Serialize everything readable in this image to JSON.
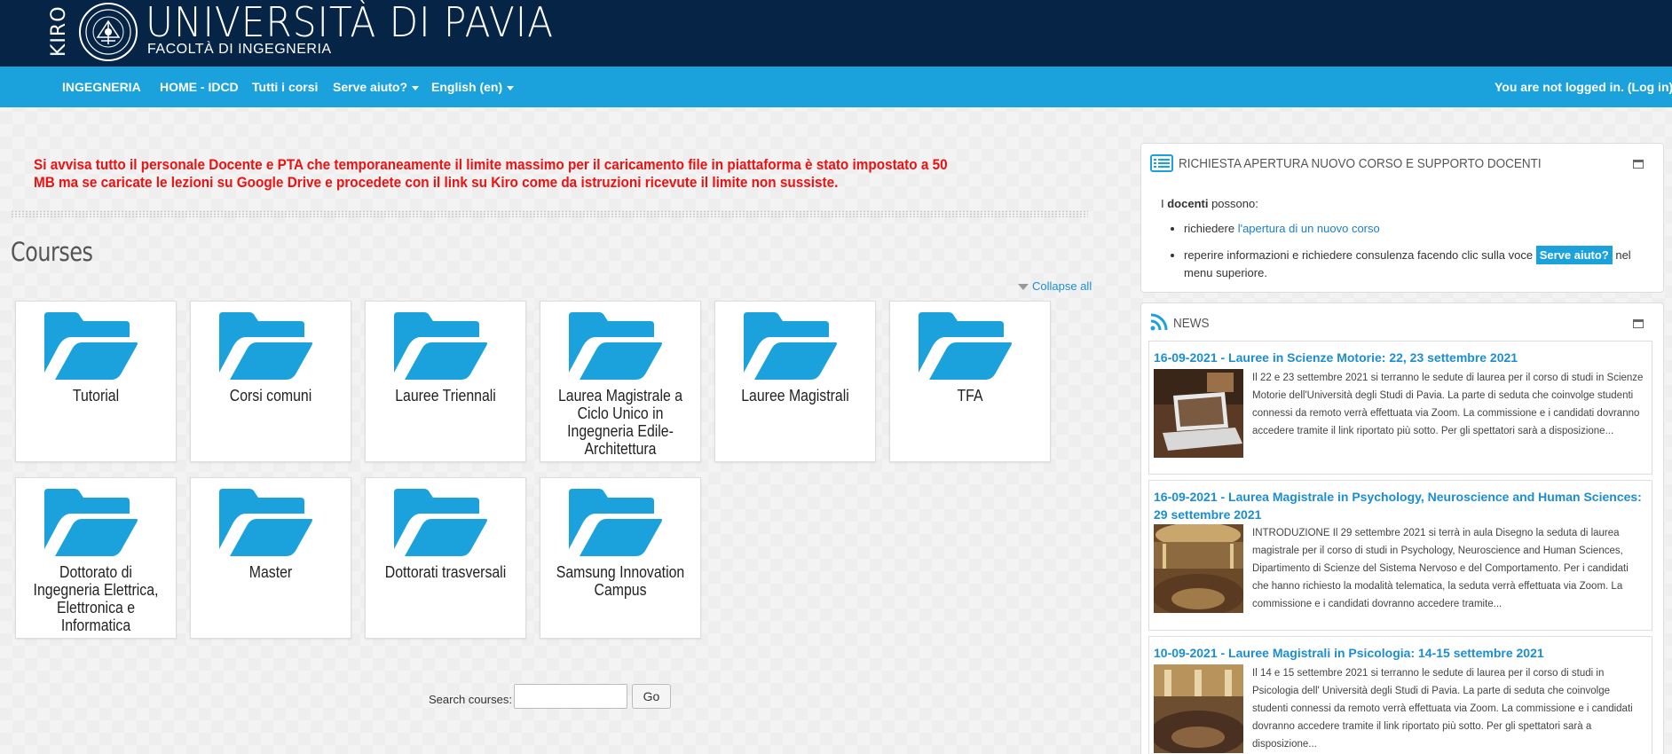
{
  "header": {
    "kiro": "KIRO",
    "university": "UNIVERSITÀ DI PAVIA",
    "faculty": "FACOLTÀ DI INGEGNERIA"
  },
  "nav": {
    "items": [
      "INGEGNERIA",
      "HOME - IDCD",
      "Tutti i corsi",
      "Serve aiuto?",
      "English (en)"
    ],
    "login_prefix": "You are not logged in. (",
    "login_link": "Log in",
    "login_suffix": ")"
  },
  "notice": "Si avvisa tutto il personale Docente e PTA che temporaneamente il limite massimo per il caricamento file in piattaforma è stato impostato a 50 MB ma se caricate le lezioni su Google Drive e procedete con il link su Kiro come da istruzioni ricevute il limite non sussiste.",
  "courses": {
    "heading": "Courses",
    "collapse_all": "Collapse all",
    "categories": [
      "Tutorial",
      "Corsi comuni",
      "Lauree Triennali",
      "Laurea Magistrale a Ciclo Unico in Ingegneria Edile-Architettura",
      "Lauree Magistrali",
      "TFA",
      "Dottorato di Ingegneria Elettrica, Elettronica e Informatica",
      "Master",
      "Dottorati trasversali",
      "Samsung Innovation Campus"
    ],
    "search_label": "Search courses:",
    "search_value": "",
    "go_label": "Go"
  },
  "request_block": {
    "title": "RICHIESTA APERTURA NUOVO CORSO E SUPPORTO DOCENTI",
    "intro_prefix": "I ",
    "intro_bold": "docenti",
    "intro_suffix": " possono:",
    "item1_prefix": "richiedere ",
    "item1_link": "l'apertura di un nuovo corso",
    "item2_prefix": "reperire informazioni e richiedere consulenza facendo clic sulla voce ",
    "item2_badge": "Serve aiuto?",
    "item2_suffix": " nel menu superiore."
  },
  "news": {
    "title": "NEWS",
    "items": [
      {
        "title": "16-09-2021 - Lauree in Scienze Motorie: 22, 23 settembre 2021",
        "text": "Il 22 e 23 settembre 2021 si terranno le sedute di laurea per il corso di studi in Scienze Motorie dell'Università degli Studi di Pavia. La parte di seduta che coinvolge studenti connessi da remoto verrà effettuata via Zoom. La commissione e i candidati dovranno accedere tramite il link riportato più sotto. Per gli spettatori sarà a disposizione..."
      },
      {
        "title": "16-09-2021 - Laurea Magistrale in Psychology, Neuroscience and Human Sciences: 29 settembre 2021",
        "text": "INTRODUZIONE Il 29 settembre 2021 si terrà in aula Disegno la seduta di laurea magistrale per il corso di studi in Psychology, Neuroscience and Human Sciences, Dipartimento di Scienze del Sistema Nervoso e del Comportamento. Per i candidati che hanno richiesto la modalità telematica, la seduta verrà effettuata via Zoom. La commissione e i candidati dovranno accedere tramite..."
      },
      {
        "title": "10-09-2021 - Lauree Magistrali in Psicologia: 14-15 settembre 2021",
        "text": "Il 14 e 15 settembre 2021 si terranno le sedute di laurea per il corso di studi in Psicologia dell' Università degli Studi di Pavia. La parte di seduta che coinvolge studenti connessi da remoto verrà effettuata via Zoom. La commissione e i candidati dovranno accedere tramite il link riportato più sotto. Per gli spettatori sarà a disposizione..."
      }
    ]
  },
  "colors": {
    "header_bg": "#052446",
    "nav_bg": "#1ba2dd",
    "notice": "#ee1111",
    "link": "#1b8ed3",
    "folder": "#1ba2dd"
  },
  "icons": [
    "folder-icon",
    "list-icon",
    "rss-icon",
    "minimize-icon",
    "caret-down-icon",
    "university-seal-icon"
  ]
}
